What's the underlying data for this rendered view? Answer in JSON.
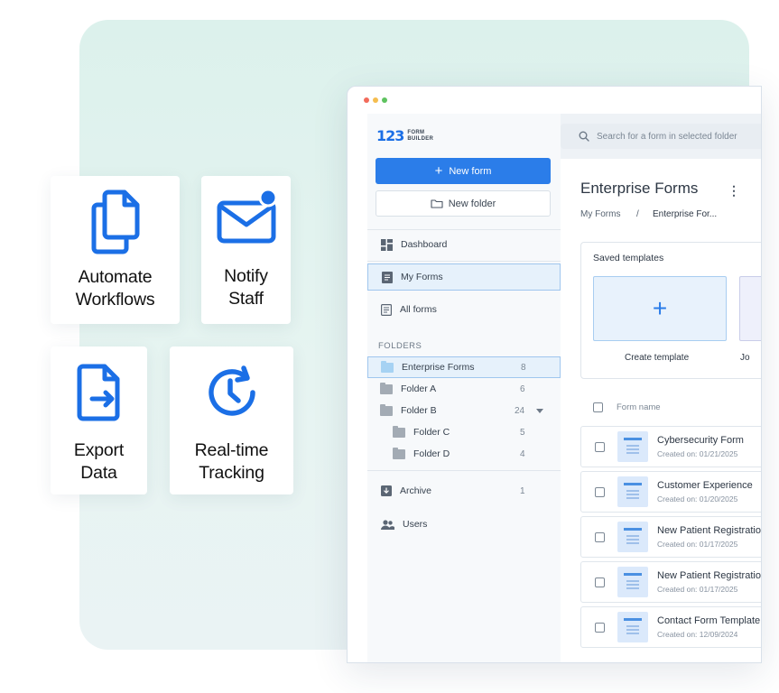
{
  "colors": {
    "accent": "#2b7de9",
    "panel_bg": "#dcf1ec",
    "dot_red": "#f26b5b",
    "dot_yellow": "#f5bd4f",
    "dot_green": "#5ec25f"
  },
  "features": [
    {
      "icon": "copy-documents-icon",
      "line1": "Automate",
      "line2": "Workflows"
    },
    {
      "icon": "mail-notification-icon",
      "line1": "Notify",
      "line2": "Staff"
    },
    {
      "icon": "file-export-icon",
      "line1": "Export",
      "line2": "Data"
    },
    {
      "icon": "clock-refresh-icon",
      "line1": "Real-time",
      "line2": "Tracking"
    }
  ],
  "app": {
    "logo": {
      "number": "123",
      "word1": "FORM",
      "word2": "BUILDER"
    },
    "search_placeholder": "Search for a form in selected folder",
    "new_form_label": "New form",
    "new_folder_label": "New folder",
    "nav": [
      {
        "icon": "dashboard-icon",
        "label": "Dashboard"
      },
      {
        "icon": "my-forms-icon",
        "label": "My Forms"
      },
      {
        "icon": "all-forms-icon",
        "label": "All forms"
      }
    ],
    "folders_heading": "FOLDERS",
    "folders": [
      {
        "name": "Enterprise Forms",
        "count": "8"
      },
      {
        "name": "Folder A",
        "count": "6"
      },
      {
        "name": "Folder B",
        "count": "24"
      },
      {
        "name": "Folder C",
        "count": "5"
      },
      {
        "name": "Folder D",
        "count": "4"
      }
    ],
    "archive": {
      "label": "Archive",
      "count": "1"
    },
    "users_label": "Users",
    "main_title": "Enterprise Forms",
    "breadcrumb": {
      "root": "My Forms",
      "separator": "/",
      "current": "Enterprise For..."
    },
    "saved_templates_title": "Saved templates",
    "create_template_label": "Create template",
    "second_template_label": "Jo",
    "form_name_header": "Form name",
    "forms": [
      {
        "name": "Cybersecurity Form",
        "date": "Created on: 01/21/2025"
      },
      {
        "name": "Customer Experience",
        "date": "Created on: 01/20/2025"
      },
      {
        "name": "New Patient Registration",
        "date": "Created on: 01/17/2025"
      },
      {
        "name": "New Patient Registration",
        "date": "Created on: 01/17/2025"
      },
      {
        "name": "Contact Form Template",
        "date": "Created on: 12/09/2024"
      }
    ]
  }
}
